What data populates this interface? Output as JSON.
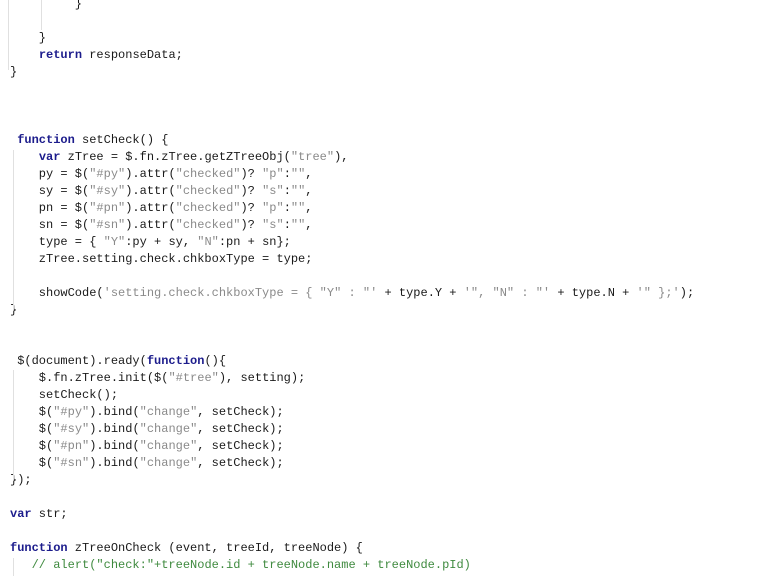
{
  "editor": {
    "lines": [
      [
        [
          "p",
          "         }"
        ]
      ],
      [],
      [
        [
          "p",
          "    }"
        ]
      ],
      [
        [
          "p",
          "    "
        ],
        [
          "kw",
          "return"
        ],
        [
          "p",
          " responseData;"
        ]
      ],
      [
        [
          "p",
          "}"
        ]
      ],
      [],
      [],
      [],
      [
        [
          "p",
          " "
        ],
        [
          "kw",
          "function"
        ],
        [
          "p",
          " setCheck() {"
        ]
      ],
      [
        [
          "p",
          "    "
        ],
        [
          "kw",
          "var"
        ],
        [
          "p",
          " zTree = $.fn.zTree.getZTreeObj("
        ],
        [
          "str",
          "\"tree\""
        ],
        [
          "p",
          "),"
        ]
      ],
      [
        [
          "p",
          "    py = $("
        ],
        [
          "str",
          "\"#py\""
        ],
        [
          "p",
          ").attr("
        ],
        [
          "str",
          "\"checked\""
        ],
        [
          "p",
          ")? "
        ],
        [
          "str",
          "\"p\""
        ],
        [
          "p",
          ":"
        ],
        [
          "str",
          "\"\""
        ],
        [
          "p",
          ","
        ]
      ],
      [
        [
          "p",
          "    sy = $("
        ],
        [
          "str",
          "\"#sy\""
        ],
        [
          "p",
          ").attr("
        ],
        [
          "str",
          "\"checked\""
        ],
        [
          "p",
          ")? "
        ],
        [
          "str",
          "\"s\""
        ],
        [
          "p",
          ":"
        ],
        [
          "str",
          "\"\""
        ],
        [
          "p",
          ","
        ]
      ],
      [
        [
          "p",
          "    pn = $("
        ],
        [
          "str",
          "\"#pn\""
        ],
        [
          "p",
          ").attr("
        ],
        [
          "str",
          "\"checked\""
        ],
        [
          "p",
          ")? "
        ],
        [
          "str",
          "\"p\""
        ],
        [
          "p",
          ":"
        ],
        [
          "str",
          "\"\""
        ],
        [
          "p",
          ","
        ]
      ],
      [
        [
          "p",
          "    sn = $("
        ],
        [
          "str",
          "\"#sn\""
        ],
        [
          "p",
          ").attr("
        ],
        [
          "str",
          "\"checked\""
        ],
        [
          "p",
          ")? "
        ],
        [
          "str",
          "\"s\""
        ],
        [
          "p",
          ":"
        ],
        [
          "str",
          "\"\""
        ],
        [
          "p",
          ","
        ]
      ],
      [
        [
          "p",
          "    type = { "
        ],
        [
          "str",
          "\"Y\""
        ],
        [
          "p",
          ":py + sy, "
        ],
        [
          "str",
          "\"N\""
        ],
        [
          "p",
          ":pn + sn};"
        ]
      ],
      [
        [
          "p",
          "    zTree.setting.check.chkboxType = type;"
        ]
      ],
      [],
      [
        [
          "p",
          "    showCode("
        ],
        [
          "str",
          "'setting.check.chkboxType = { \"Y\" : \"'"
        ],
        [
          "p",
          " + type.Y + "
        ],
        [
          "str",
          "'\", \"N\" : \"'"
        ],
        [
          "p",
          " + type.N + "
        ],
        [
          "str",
          "'\" };'"
        ],
        [
          "p",
          ");"
        ]
      ],
      [
        [
          "p",
          "}"
        ]
      ],
      [],
      [],
      [
        [
          "p",
          " $(document).ready("
        ],
        [
          "kw",
          "function"
        ],
        [
          "p",
          "(){"
        ]
      ],
      [
        [
          "p",
          "    $.fn.zTree.init($("
        ],
        [
          "str",
          "\"#tree\""
        ],
        [
          "p",
          "), setting);"
        ]
      ],
      [
        [
          "p",
          "    setCheck();"
        ]
      ],
      [
        [
          "p",
          "    $("
        ],
        [
          "str",
          "\"#py\""
        ],
        [
          "p",
          ").bind("
        ],
        [
          "str",
          "\"change\""
        ],
        [
          "p",
          ", setCheck);"
        ]
      ],
      [
        [
          "p",
          "    $("
        ],
        [
          "str",
          "\"#sy\""
        ],
        [
          "p",
          ").bind("
        ],
        [
          "str",
          "\"change\""
        ],
        [
          "p",
          ", setCheck);"
        ]
      ],
      [
        [
          "p",
          "    $("
        ],
        [
          "str",
          "\"#pn\""
        ],
        [
          "p",
          ").bind("
        ],
        [
          "str",
          "\"change\""
        ],
        [
          "p",
          ", setCheck);"
        ]
      ],
      [
        [
          "p",
          "    $("
        ],
        [
          "str",
          "\"#sn\""
        ],
        [
          "p",
          ").bind("
        ],
        [
          "str",
          "\"change\""
        ],
        [
          "p",
          ", setCheck);"
        ]
      ],
      [
        [
          "p",
          "});"
        ]
      ],
      [],
      [
        [
          "kw",
          "var"
        ],
        [
          "p",
          " str;"
        ]
      ],
      [],
      [
        [
          "kw",
          "function"
        ],
        [
          "p",
          " zTreeOnCheck (event, treeId, treeNode) {"
        ]
      ],
      [
        [
          "p",
          "   "
        ],
        [
          "cm",
          "// alert(\"check:\"+treeNode.id + treeNode.name + treeNode.pId)"
        ]
      ]
    ]
  },
  "colors": {
    "keyword": "#1c1c8c",
    "string": "#8a8a8a",
    "comment": "#3f8a3f"
  }
}
